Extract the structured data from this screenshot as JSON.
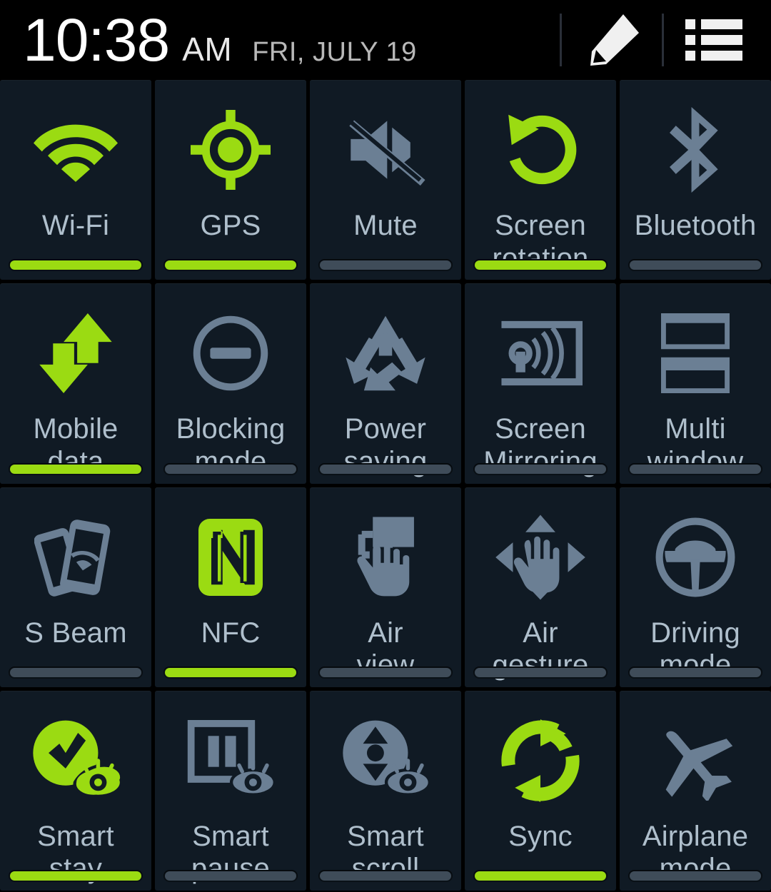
{
  "status_bar": {
    "time": "10:38",
    "ampm": "AM",
    "date": "FRI, JULY 19",
    "edit_icon": "pencil-icon",
    "list_icon": "list-icon"
  },
  "colors": {
    "accent_green": "#9bdb12",
    "icon_inactive": "#6b7f94",
    "label": "#afbfcc",
    "tile_bg": "#101a24",
    "page_bg": "#000000",
    "bar_inactive": "#3f4c59"
  },
  "grid": {
    "columns": 5,
    "rows": 4,
    "tiles": [
      {
        "label": "Wi-Fi",
        "icon": "wifi-icon",
        "state": "on"
      },
      {
        "label": "GPS",
        "icon": "gps-icon",
        "state": "on"
      },
      {
        "label": "Mute",
        "icon": "mute-icon",
        "state": "off"
      },
      {
        "label": "Screen\nrotation",
        "icon": "screen-rotation-icon",
        "state": "on"
      },
      {
        "label": "Bluetooth",
        "icon": "bluetooth-icon",
        "state": "off"
      },
      {
        "label": "Mobile\ndata",
        "icon": "mobile-data-icon",
        "state": "on"
      },
      {
        "label": "Blocking\nmode",
        "icon": "blocking-mode-icon",
        "state": "off"
      },
      {
        "label": "Power\nsaving",
        "icon": "power-saving-icon",
        "state": "off"
      },
      {
        "label": "Screen\nMirroring",
        "icon": "screen-mirroring-icon",
        "state": "off"
      },
      {
        "label": "Multi\nwindow",
        "icon": "multi-window-icon",
        "state": "off"
      },
      {
        "label": "S Beam",
        "icon": "s-beam-icon",
        "state": "off"
      },
      {
        "label": "NFC",
        "icon": "nfc-icon",
        "state": "on"
      },
      {
        "label": "Air\nview",
        "icon": "air-view-icon",
        "state": "off"
      },
      {
        "label": "Air\ngesture",
        "icon": "air-gesture-icon",
        "state": "off"
      },
      {
        "label": "Driving\nmode",
        "icon": "driving-mode-icon",
        "state": "off"
      },
      {
        "label": "Smart\nstay",
        "icon": "smart-stay-icon",
        "state": "on"
      },
      {
        "label": "Smart\npause",
        "icon": "smart-pause-icon",
        "state": "off"
      },
      {
        "label": "Smart\nscroll",
        "icon": "smart-scroll-icon",
        "state": "off"
      },
      {
        "label": "Sync",
        "icon": "sync-icon",
        "state": "on"
      },
      {
        "label": "Airplane\nmode",
        "icon": "airplane-mode-icon",
        "state": "off"
      }
    ]
  }
}
